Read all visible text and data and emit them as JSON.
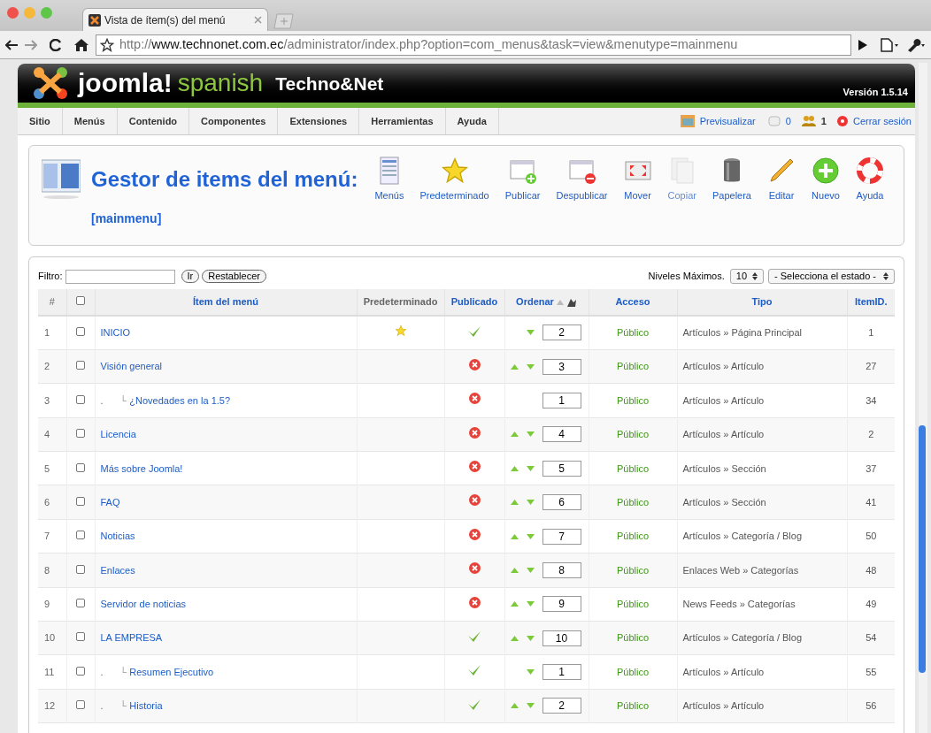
{
  "browser": {
    "tab_title": "Vista de ítem(s) del menú",
    "url_scheme": "http://",
    "url_host": "www.technonet.com.ec",
    "url_path": "/administrator/index.php?option=com_menus&task=view&menutype=mainmenu"
  },
  "header": {
    "brand": "joomla!",
    "brand_sub": "spanish",
    "site": "Techno&Net",
    "version": "Versión 1.5.14"
  },
  "menu": [
    "Sitio",
    "Menús",
    "Contenido",
    "Componentes",
    "Extensiones",
    "Herramientas",
    "Ayuda"
  ],
  "status": {
    "preview": "Previsualizar",
    "messages": "0",
    "users": "1",
    "logout": "Cerrar sesión"
  },
  "page": {
    "title": "Gestor de items del menú:",
    "subtitle": "[mainmenu]"
  },
  "toolbar": [
    {
      "kind": "menus",
      "label": "Menús",
      "disabled": false
    },
    {
      "kind": "default",
      "label": "Predeterminado",
      "disabled": false
    },
    {
      "kind": "publish",
      "label": "Publicar",
      "disabled": false
    },
    {
      "kind": "unpublish",
      "label": "Despublicar",
      "disabled": false
    },
    {
      "kind": "move",
      "label": "Mover",
      "disabled": false
    },
    {
      "kind": "copy",
      "label": "Copiar",
      "disabled": true
    },
    {
      "kind": "trash",
      "label": "Papelera",
      "disabled": false
    },
    {
      "kind": "edit",
      "label": "Editar",
      "disabled": false
    },
    {
      "kind": "new",
      "label": "Nuevo",
      "disabled": false
    },
    {
      "kind": "help",
      "label": "Ayuda",
      "disabled": false
    }
  ],
  "filter": {
    "label": "Filtro:",
    "go": "Ir",
    "reset": "Restablecer",
    "levels_label": "Niveles Máximos.",
    "levels_value": "10",
    "state_value": "- Selecciona el estado -"
  },
  "table": {
    "select_all_checked": false,
    "columns": [
      "#",
      "Ítem del menú",
      "Predeterminado",
      "Publicado",
      "Ordenar",
      "Acceso",
      "Tipo",
      "ItemID."
    ],
    "rows": [
      {
        "num": "1",
        "name": "INICIO",
        "default": true,
        "published": true,
        "up": false,
        "down": true,
        "order": "2",
        "access": "Público",
        "type": "Artículos » Página Principal",
        "id": "1",
        "checked": false
      },
      {
        "num": "2",
        "name": "Visión general",
        "default": false,
        "published": false,
        "up": true,
        "down": true,
        "order": "3",
        "access": "Público",
        "type": "Artículos » Artículo",
        "id": "27",
        "checked": false,
        "children": [
          {
            "num": "3",
            "marker": ".",
            "branch": "└",
            "name": "¿Novedades en la 1.5?",
            "default": false,
            "published": false,
            "up": false,
            "down": false,
            "order": "1",
            "access": "Público",
            "type": "Artículos » Artículo",
            "id": "34",
            "checked": false
          }
        ]
      },
      {
        "num": "4",
        "name": "Licencia",
        "default": false,
        "published": false,
        "up": true,
        "down": true,
        "order": "4",
        "access": "Público",
        "type": "Artículos » Artículo",
        "id": "2",
        "checked": false
      },
      {
        "num": "5",
        "name": "Más sobre Joomla!",
        "default": false,
        "published": false,
        "up": true,
        "down": true,
        "order": "5",
        "access": "Público",
        "type": "Artículos » Sección",
        "id": "37",
        "checked": false
      },
      {
        "num": "6",
        "name": "FAQ",
        "default": false,
        "published": false,
        "up": true,
        "down": true,
        "order": "6",
        "access": "Público",
        "type": "Artículos » Sección",
        "id": "41",
        "checked": false
      },
      {
        "num": "7",
        "name": "Noticias",
        "default": false,
        "published": false,
        "up": true,
        "down": true,
        "order": "7",
        "access": "Público",
        "type": "Artículos » Categoría / Blog",
        "id": "50",
        "checked": false
      },
      {
        "num": "8",
        "name": "Enlaces",
        "default": false,
        "published": false,
        "up": true,
        "down": true,
        "order": "8",
        "access": "Público",
        "type": "Enlaces Web » Categorías",
        "id": "48",
        "checked": false
      },
      {
        "num": "9",
        "name": "Servidor de noticias",
        "default": false,
        "published": false,
        "up": true,
        "down": true,
        "order": "9",
        "access": "Público",
        "type": "News Feeds » Categorías",
        "id": "49",
        "checked": false
      },
      {
        "num": "10",
        "name": "LA EMPRESA",
        "default": false,
        "published": true,
        "up": true,
        "down": true,
        "order": "10",
        "access": "Público",
        "type": "Artículos » Categoría / Blog",
        "id": "54",
        "checked": false,
        "children": [
          {
            "num": "11",
            "marker": ".",
            "branch": "└",
            "name": "Resumen Ejecutivo",
            "default": false,
            "published": true,
            "up": false,
            "down": true,
            "order": "1",
            "access": "Público",
            "type": "Artículos » Artículo",
            "id": "55",
            "checked": false
          },
          {
            "num": "12",
            "marker": ".",
            "branch": "└",
            "name": "Historia",
            "default": false,
            "published": true,
            "up": true,
            "down": true,
            "order": "2",
            "access": "Público",
            "type": "Artículos » Artículo",
            "id": "56",
            "checked": false
          }
        ]
      }
    ]
  }
}
